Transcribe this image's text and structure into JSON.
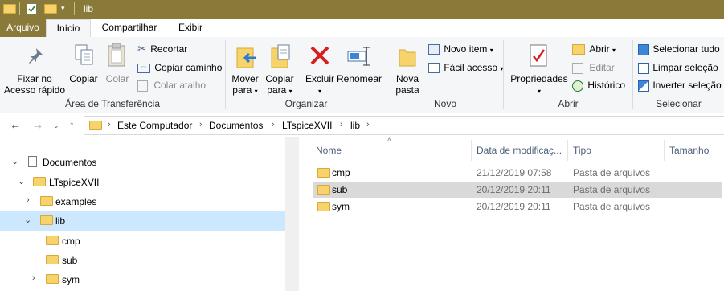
{
  "window": {
    "title": "lib"
  },
  "tabs": {
    "file": "Arquivo",
    "home": "Início",
    "share": "Compartilhar",
    "view": "Exibir"
  },
  "ribbon": {
    "clipboard": {
      "label": "Área de Transferência",
      "pin_line1": "Fixar no",
      "pin_line2": "Acesso rápido",
      "copy": "Copiar",
      "paste": "Colar",
      "cut": "Recortar",
      "copy_path": "Copiar caminho",
      "paste_shortcut": "Colar atalho"
    },
    "organize": {
      "label": "Organizar",
      "move_line1": "Mover",
      "move_line2": "para",
      "copy_line1": "Copiar",
      "copy_line2": "para",
      "delete": "Excluir",
      "rename": "Renomear"
    },
    "new": {
      "label": "Novo",
      "folder_line1": "Nova",
      "folder_line2": "pasta",
      "new_item": "Novo item",
      "easy_access": "Fácil acesso"
    },
    "open": {
      "label": "Abrir",
      "properties": "Propriedades",
      "open": "Abrir",
      "edit": "Editar",
      "history": "Histórico"
    },
    "select": {
      "label": "Selecionar",
      "select_all": "Selecionar tudo",
      "select_none": "Limpar seleção",
      "invert": "Inverter seleção"
    }
  },
  "address": {
    "crumbs": [
      "Este Computador",
      "Documentos",
      "LTspiceXVII",
      "lib"
    ]
  },
  "tree": [
    {
      "label": "Documentos",
      "expanded": true
    },
    {
      "label": "LTspiceXVII",
      "expanded": true
    },
    {
      "label": "examples",
      "expanded": false
    },
    {
      "label": "lib",
      "expanded": true,
      "selected": true
    },
    {
      "label": "cmp"
    },
    {
      "label": "sub"
    },
    {
      "label": "sym",
      "expanded": false
    }
  ],
  "columns": {
    "name": "Nome",
    "date": "Data de modificaç...",
    "type": "Tipo",
    "size": "Tamanho"
  },
  "files": [
    {
      "name": "cmp",
      "date": "21/12/2019 07:58",
      "type": "Pasta de arquivos"
    },
    {
      "name": "sub",
      "date": "20/12/2019 20:11",
      "type": "Pasta de arquivos",
      "selected": true
    },
    {
      "name": "sym",
      "date": "20/12/2019 20:11",
      "type": "Pasta de arquivos"
    }
  ],
  "colors": {
    "titlebar": "#8a7a3a",
    "ribbon_bg": "#f5f6f7",
    "tree_selected": "#cce8ff",
    "row_selected": "#d9d9d9",
    "folder": "#f6d36b"
  }
}
